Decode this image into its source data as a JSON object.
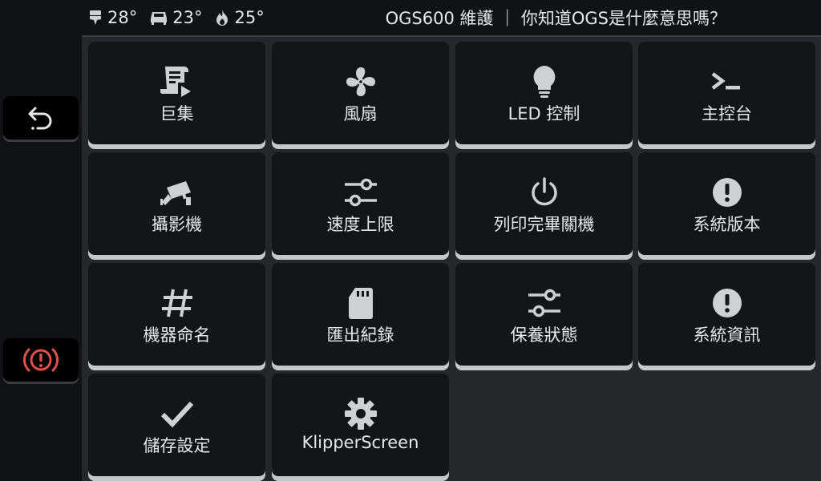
{
  "topbar": {
    "temps": [
      {
        "icon": "nozzle-icon",
        "value": "28°"
      },
      {
        "icon": "bed-icon",
        "value": "23°"
      },
      {
        "icon": "flame-icon",
        "value": "25°"
      }
    ],
    "status_text": "OGS600 維護 ｜ 你知道OGS是什麼意思嗎？"
  },
  "sidebar": {
    "back_icon": "back-arrow-icon",
    "estop_icon": "emergency-stop-icon",
    "estop_color": "#e04f4c"
  },
  "tiles": [
    {
      "label": "巨集",
      "icon": "macro-script-icon"
    },
    {
      "label": "風扇",
      "icon": "fan-icon"
    },
    {
      "label": "LED 控制",
      "icon": "lightbulb-icon"
    },
    {
      "label": "主控台",
      "icon": "console-icon"
    },
    {
      "label": "攝影機",
      "icon": "camera-icon"
    },
    {
      "label": "速度上限",
      "icon": "sliders-icon"
    },
    {
      "label": "列印完畢關機",
      "icon": "power-icon"
    },
    {
      "label": "系統版本",
      "icon": "alert-circle-icon"
    },
    {
      "label": "機器命名",
      "icon": "hash-icon"
    },
    {
      "label": "匯出紀錄",
      "icon": "sd-card-icon"
    },
    {
      "label": "保養狀態",
      "icon": "sliders-icon"
    },
    {
      "label": "系統資訊",
      "icon": "alert-circle-icon"
    },
    {
      "label": "儲存設定",
      "icon": "checkmark-icon"
    },
    {
      "label": "KlipperScreen",
      "icon": "gear-icon"
    }
  ],
  "colors": {
    "icon": "#cfd0d4",
    "tile_bg": "#141518",
    "tile_underline": "#c6c7cb",
    "panel_bg": "#25272b"
  }
}
